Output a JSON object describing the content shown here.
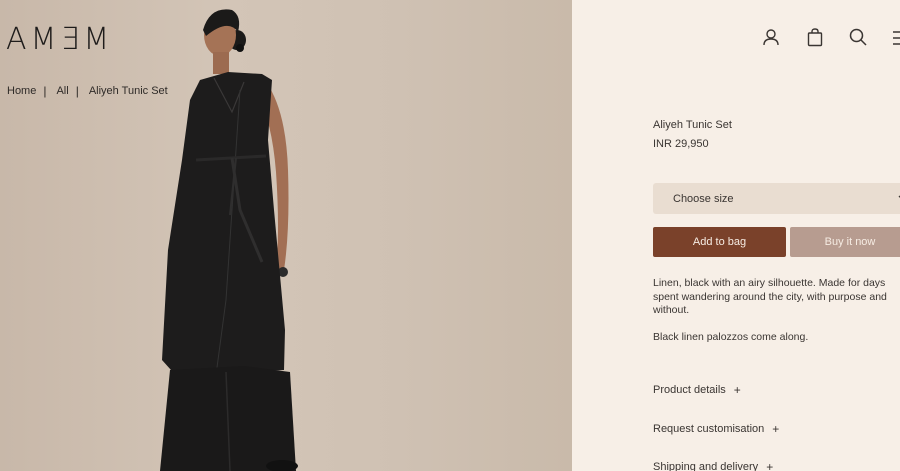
{
  "brand": {
    "logo_text": "AMƎM"
  },
  "breadcrumb": {
    "items": [
      "Home",
      "All",
      "Aliyeh Tunic Set"
    ],
    "separator": "|"
  },
  "header": {
    "icons": [
      "user-icon",
      "bag-icon",
      "search-icon",
      "menu-icon"
    ]
  },
  "product": {
    "title": "Aliyeh Tunic Set",
    "price": "INR 29,950",
    "size_select": {
      "label": "Choose size"
    },
    "add_to_bag_label": "Add to bag",
    "buy_now_label": "Buy it now",
    "description": [
      "Linen, black with an airy silhouette. Made for days spent wandering around the city, with purpose and without.",
      "Black linen palozzos come along."
    ],
    "accordion": [
      {
        "label": "Product details",
        "icon": "+"
      },
      {
        "label": "Request customisation",
        "icon": "+"
      },
      {
        "label": "Shipping and delivery",
        "icon": "+"
      }
    ]
  },
  "colors": {
    "panel_bg": "#f7efe7",
    "add_to_bag": "#7a412a",
    "buy_now": "#b79c90",
    "select_bg": "#e9ddd1"
  }
}
